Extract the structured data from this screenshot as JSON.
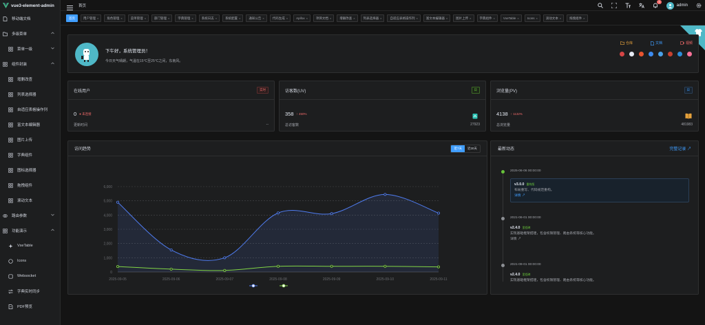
{
  "app": {
    "name": "vue3-element-admin"
  },
  "sidebar": {
    "items": [
      {
        "label": "移动端文档",
        "level": 1,
        "icon": "document-icon"
      },
      {
        "label": "多级菜单",
        "level": 1,
        "icon": "folder-icon",
        "expanded": true
      },
      {
        "label": "菜单一级",
        "level": 2,
        "icon": "grid-icon",
        "chevron": "down"
      },
      {
        "label": "组件封装",
        "level": 1,
        "icon": "grid-icon",
        "expanded": true
      },
      {
        "label": "增删改查",
        "level": 2,
        "icon": "grid-icon"
      },
      {
        "label": "列表选择器",
        "level": 2,
        "icon": "grid-icon"
      },
      {
        "label": "自适应表格操作列",
        "level": 2,
        "icon": "grid-icon"
      },
      {
        "label": "富文本编辑器",
        "level": 2,
        "icon": "grid-icon"
      },
      {
        "label": "图片上传",
        "level": 2,
        "icon": "grid-icon"
      },
      {
        "label": "字典组件",
        "level": 2,
        "icon": "grid-icon"
      },
      {
        "label": "图标选择器",
        "level": 2,
        "icon": "grid-icon"
      },
      {
        "label": "拖拽组件",
        "level": 2,
        "icon": "grid-icon"
      },
      {
        "label": "滚动文本",
        "level": 2,
        "icon": "grid-icon"
      },
      {
        "label": "路由参数",
        "level": 1,
        "icon": "link-icon",
        "chevron": "down"
      },
      {
        "label": "功能演示",
        "level": 1,
        "icon": "grid-icon",
        "expanded": true
      },
      {
        "label": "VxeTable",
        "level": 2,
        "icon": "sparkle-icon"
      },
      {
        "label": "Icons",
        "level": 2,
        "icon": "circle-icon"
      },
      {
        "label": "Websocket",
        "level": 2,
        "icon": "box-icon"
      },
      {
        "label": "字典实时同步",
        "level": 2,
        "icon": "swap-icon"
      },
      {
        "label": "PDF预览",
        "level": 2,
        "icon": "file-icon"
      }
    ]
  },
  "header": {
    "breadcrumb": "首页",
    "notification_count": "3",
    "username": "admin"
  },
  "tags": [
    {
      "label": "首页",
      "active": true
    },
    {
      "label": "用户管理"
    },
    {
      "label": "角色管理"
    },
    {
      "label": "菜单管理"
    },
    {
      "label": "部门管理"
    },
    {
      "label": "字典管理"
    },
    {
      "label": "系统日志"
    },
    {
      "label": "系统配置"
    },
    {
      "label": "通知公告"
    },
    {
      "label": "代码生成"
    },
    {
      "label": "Apifox"
    },
    {
      "label": "项目文档"
    },
    {
      "label": "增删改查"
    },
    {
      "label": "列表选择器"
    },
    {
      "label": "自适应表格操作列"
    },
    {
      "label": "富文本编辑器"
    },
    {
      "label": "图片上传"
    },
    {
      "label": "字典组件"
    },
    {
      "label": "VxeTable"
    },
    {
      "label": "Icons"
    },
    {
      "label": "滚动文本"
    },
    {
      "label": "拖拽组件"
    }
  ],
  "greeting": {
    "title": "下午好，系统管理员！",
    "subtitle": "今日天气晴朗，气温在15°C至25°C之间，东南风。",
    "links": [
      {
        "label": "仓库",
        "color": "#e6a23c"
      },
      {
        "label": "文档",
        "color": "#409eff"
      },
      {
        "label": "视频",
        "color": "#f56c6c"
      }
    ],
    "platform_colors": [
      "#d64545",
      "#e5eaf3",
      "#e8542f",
      "#3d8cf0",
      "#4aa1e8",
      "#c8412f",
      "#2c8ed9",
      "#fb7299"
    ]
  },
  "cards": [
    {
      "title": "在线用户",
      "tag": "实时",
      "tag_color": "#f56c6c",
      "value": "0",
      "trend": "未连接",
      "trend_color": "#f56c6c",
      "foot_label": "更新时间",
      "foot_value": "--",
      "icon": ""
    },
    {
      "title": "访客数(UV)",
      "tag": "日",
      "tag_color": "#67c23a",
      "value": "358",
      "trend": "↑ 450%",
      "trend_color": "#f56c6c",
      "foot_label": "总访客数",
      "foot_value": "27923",
      "icon": "visitor-icon"
    },
    {
      "title": "浏览量(PV)",
      "tag": "日",
      "tag_color": "#409eff",
      "value": "4138",
      "trend": "↑ 1132%",
      "trend_color": "#f56c6c",
      "foot_label": "总浏览量",
      "foot_value": "481983",
      "icon": "book-icon"
    }
  ],
  "trend": {
    "title": "访问趋势",
    "range_options": [
      "近7天",
      "近30天"
    ],
    "selected_range": "近7天"
  },
  "chart_data": {
    "type": "line",
    "x": [
      "2025-09-05",
      "2025-09-06",
      "2025-09-07",
      "2025-09-08",
      "2025-09-09",
      "2025-09-10",
      "2025-09-11"
    ],
    "ylim": [
      0,
      6000
    ],
    "yticks": [
      "0",
      "1,000",
      "2,000",
      "3,000",
      "4,000",
      "5,000",
      "6,000"
    ],
    "series": [
      {
        "values": [
          4900,
          1550,
          1000,
          4150,
          4100,
          5450,
          4138
        ],
        "color": "#4f7cf0",
        "area": true
      },
      {
        "values": [
          380,
          200,
          110,
          400,
          400,
          400,
          358
        ],
        "color": "#82d645",
        "area": false
      }
    ],
    "grid": true,
    "legend": "bottom-center"
  },
  "news": {
    "title": "最新动态",
    "more": "完整记录",
    "items": [
      {
        "time": "2025-06-06 00:00:00",
        "version": "v3.0.0",
        "tag": "重构版",
        "desc": "布局重写、代码规范重构。",
        "detail": "详情",
        "highlight": true,
        "dot_color": "#67c23a"
      },
      {
        "time": "2021-06-01 00:00:00",
        "version": "v2.4.0",
        "tag": "里程碑",
        "desc": "实现基础框架搭建，包含权限管理、路由系统等核心功能。",
        "detail": "详情",
        "highlight": false,
        "dot_color": "#8d9095"
      },
      {
        "time": "2021-09-01 00:00:00",
        "version": "v2.4.0",
        "tag": "里程碑",
        "desc": "实现基础框架搭建，包含权限管理、路由系统等核心功能。",
        "detail": "",
        "highlight": false,
        "dot_color": "#8d9095"
      }
    ]
  }
}
